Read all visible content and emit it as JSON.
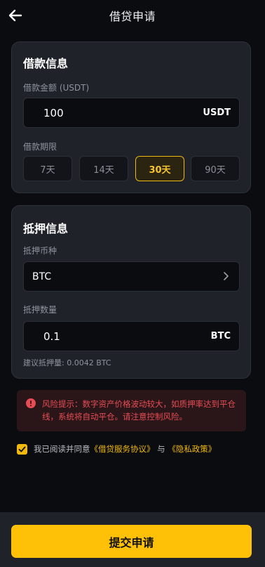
{
  "header": {
    "title": "借贷申请"
  },
  "loan_info": {
    "title": "借款信息",
    "amount_label": "借款金额 (USDT)",
    "amount_value": "100",
    "amount_unit": "USDT",
    "term_label": "借款期限",
    "terms": [
      {
        "label": "7天",
        "selected": false
      },
      {
        "label": "14天",
        "selected": false
      },
      {
        "label": "30天",
        "selected": true
      },
      {
        "label": "90天",
        "selected": false
      }
    ]
  },
  "collateral_info": {
    "title": "抵押信息",
    "currency_label": "抵押币种",
    "currency_value": "BTC",
    "quantity_label": "抵押数量",
    "quantity_value": "0.1",
    "quantity_unit": "BTC",
    "suggestion": "建议抵押量: 0.0042 BTC"
  },
  "risk_warning": {
    "text": "风险提示：数字资产价格波动较大，如质押率达到平仓线，系统将自动平仓。请注意控制风险。"
  },
  "agreement": {
    "checked": true,
    "prefix": "我已阅读并同意",
    "loan_agreement": "《借贷服务协议》",
    "conjunction": "与",
    "privacy_policy": "《隐私政策》"
  },
  "footer": {
    "submit_label": "提交申请"
  },
  "colors": {
    "accent": "#f0b90b",
    "background": "#0b0c0f",
    "card": "#1f2229",
    "danger": "#e74c55"
  }
}
